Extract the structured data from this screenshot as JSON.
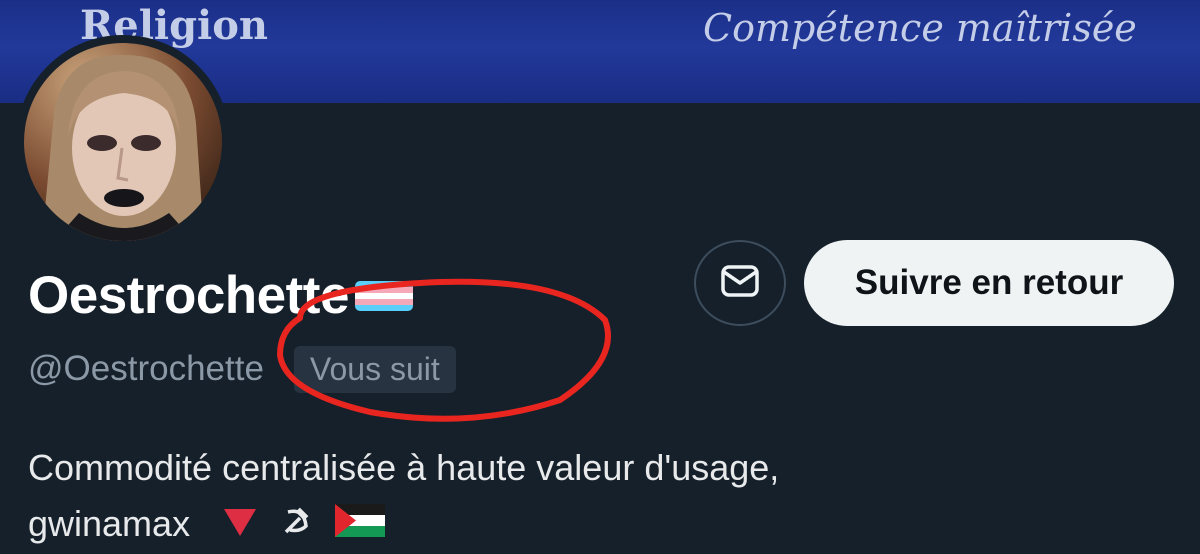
{
  "banner": {
    "left_text": "Religion",
    "right_text": "Compétence maîtrisée"
  },
  "profile": {
    "display_name": "Oestrochette",
    "name_flag_icon": "transgender-flag-icon",
    "handle": "@Oestrochette",
    "follows_you_badge": "Vous suit",
    "follow_back_label": "Suivre en retour",
    "message_icon": "envelope-icon",
    "bio_line1": "Commodité centralisée à haute valeur d'usage,",
    "bio_line2": "gwinamax",
    "bio_emojis": [
      "red-triangle-down-icon",
      "hammer-sickle-icon",
      "palestine-flag-icon"
    ]
  },
  "annotation": {
    "color": "#e8261f",
    "shape": "hand-drawn ellipse around follows-you badge"
  },
  "colors": {
    "background": "#15202b",
    "follow_button_bg": "#eff3f4",
    "secondary_text": "#8b98a5"
  }
}
